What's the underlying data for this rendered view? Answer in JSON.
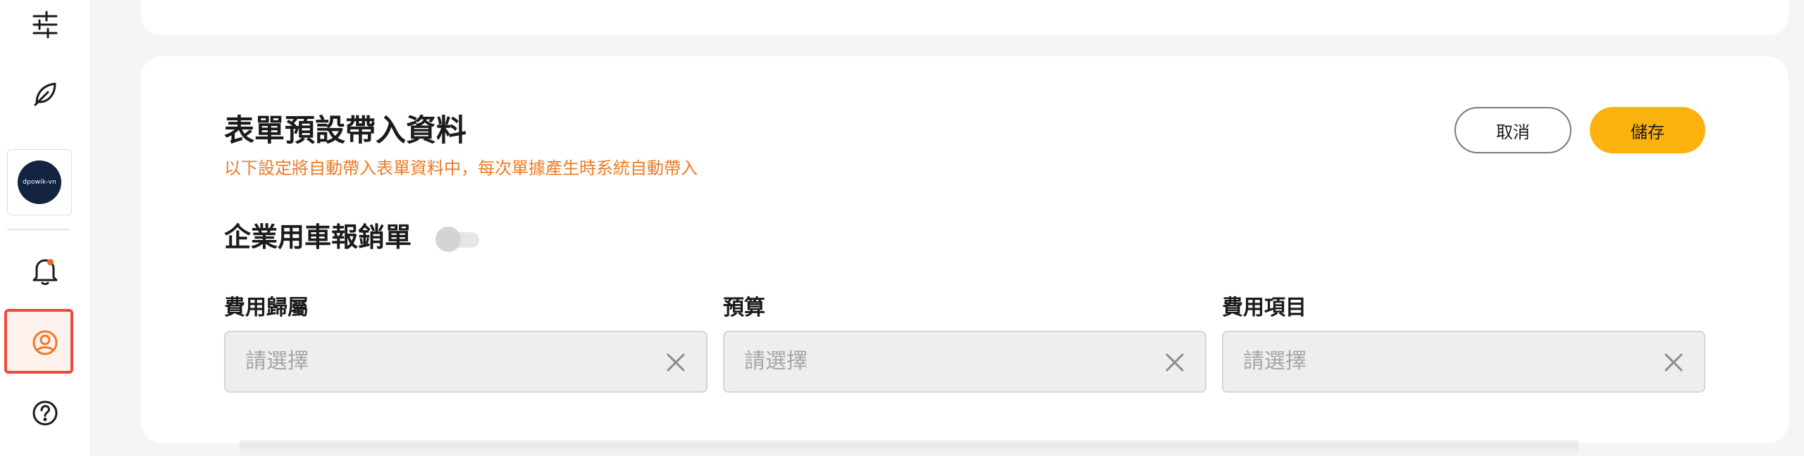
{
  "sidebar": {
    "icons": [
      "sliders-icon",
      "leaf-icon",
      "bell-icon",
      "user-circle-icon",
      "help-icon"
    ],
    "org_logo_text": "dpowik-vn",
    "notification_dot_color": "#f0642a",
    "active_item": "profile",
    "active_highlight_color": "#f0483e"
  },
  "form": {
    "title": "表單預設帶入資料",
    "subtitle": "以下設定將自動帶入表單資料中，每次單據產生時系統自動帶入",
    "cancel_label": "取消",
    "save_label": "儲存",
    "section_title": "企業用車報銷單",
    "section_toggle_on": false,
    "fields": [
      {
        "label": "費用歸屬",
        "placeholder": "請選擇"
      },
      {
        "label": "預算",
        "placeholder": "請選擇"
      },
      {
        "label": "費用項目",
        "placeholder": "請選擇"
      }
    ]
  },
  "colors": {
    "accent": "#fbb20e",
    "subtitle": "#f07a23",
    "text": "#1b1b1b"
  }
}
